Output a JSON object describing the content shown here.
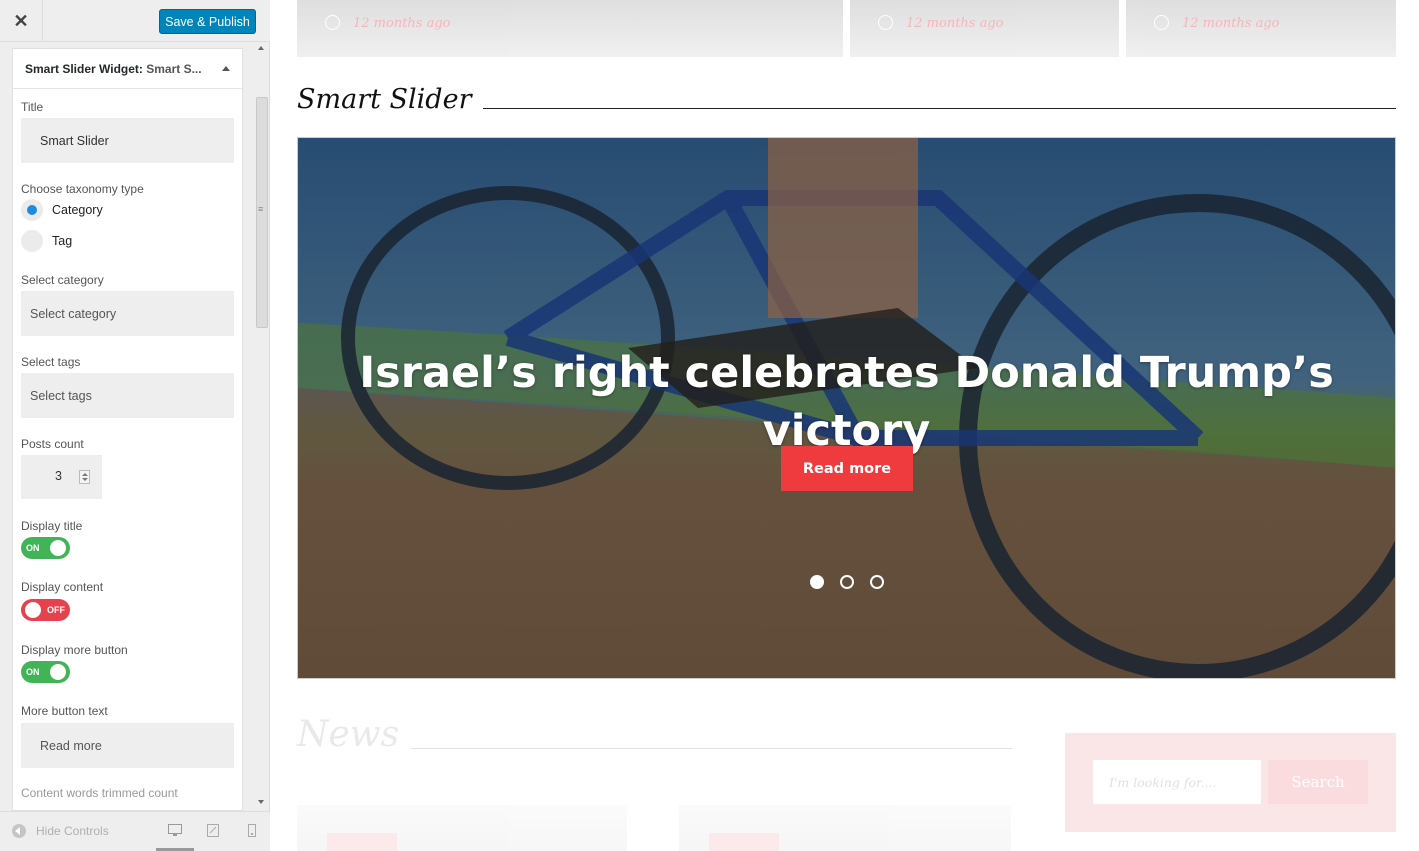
{
  "panel": {
    "close_label": "✕",
    "save_label": "Save & Publish",
    "widget": {
      "title_prefix": "Smart Slider Widget: ",
      "title_suffix": "Smart S...",
      "fields": {
        "title_label": "Title",
        "title_value": "Smart Slider",
        "taxonomy_label": "Choose taxonomy type",
        "taxonomy_options": [
          "Category",
          "Tag"
        ],
        "taxonomy_selected": "Category",
        "category_label": "Select category",
        "category_placeholder": "Select category",
        "tags_label": "Select tags",
        "tags_placeholder": "Select tags",
        "posts_count_label": "Posts count",
        "posts_count_value": "3",
        "display_title_label": "Display title",
        "display_title_state": "ON",
        "display_content_label": "Display content",
        "display_content_state": "OFF",
        "display_more_label": "Display more button",
        "display_more_state": "ON",
        "more_text_label": "More button text",
        "more_text_value": "Read more",
        "trim_label": "Content words trimmed count"
      }
    },
    "footer": {
      "hide_controls": "Hide Controls",
      "devices": [
        "desktop-icon",
        "tablet-icon",
        "mobile-icon"
      ]
    }
  },
  "preview": {
    "top_cards": [
      {
        "ago": "12 months ago"
      },
      {
        "ago": "12 months ago"
      },
      {
        "ago": "12 months ago"
      }
    ],
    "slider_section_title": "Smart Slider",
    "slide": {
      "title": "Israel’s right celebrates Donald Trump’s victory",
      "button": "Read more",
      "dots": 3,
      "active_dot": 0
    },
    "news_section_title": "News",
    "search": {
      "placeholder": "I'm looking for....",
      "button": "Search"
    },
    "colors": {
      "accent": "#ef3b3e",
      "toggle_on": "#41b458",
      "toggle_off": "#e5424d",
      "primary": "#0085ba"
    }
  }
}
